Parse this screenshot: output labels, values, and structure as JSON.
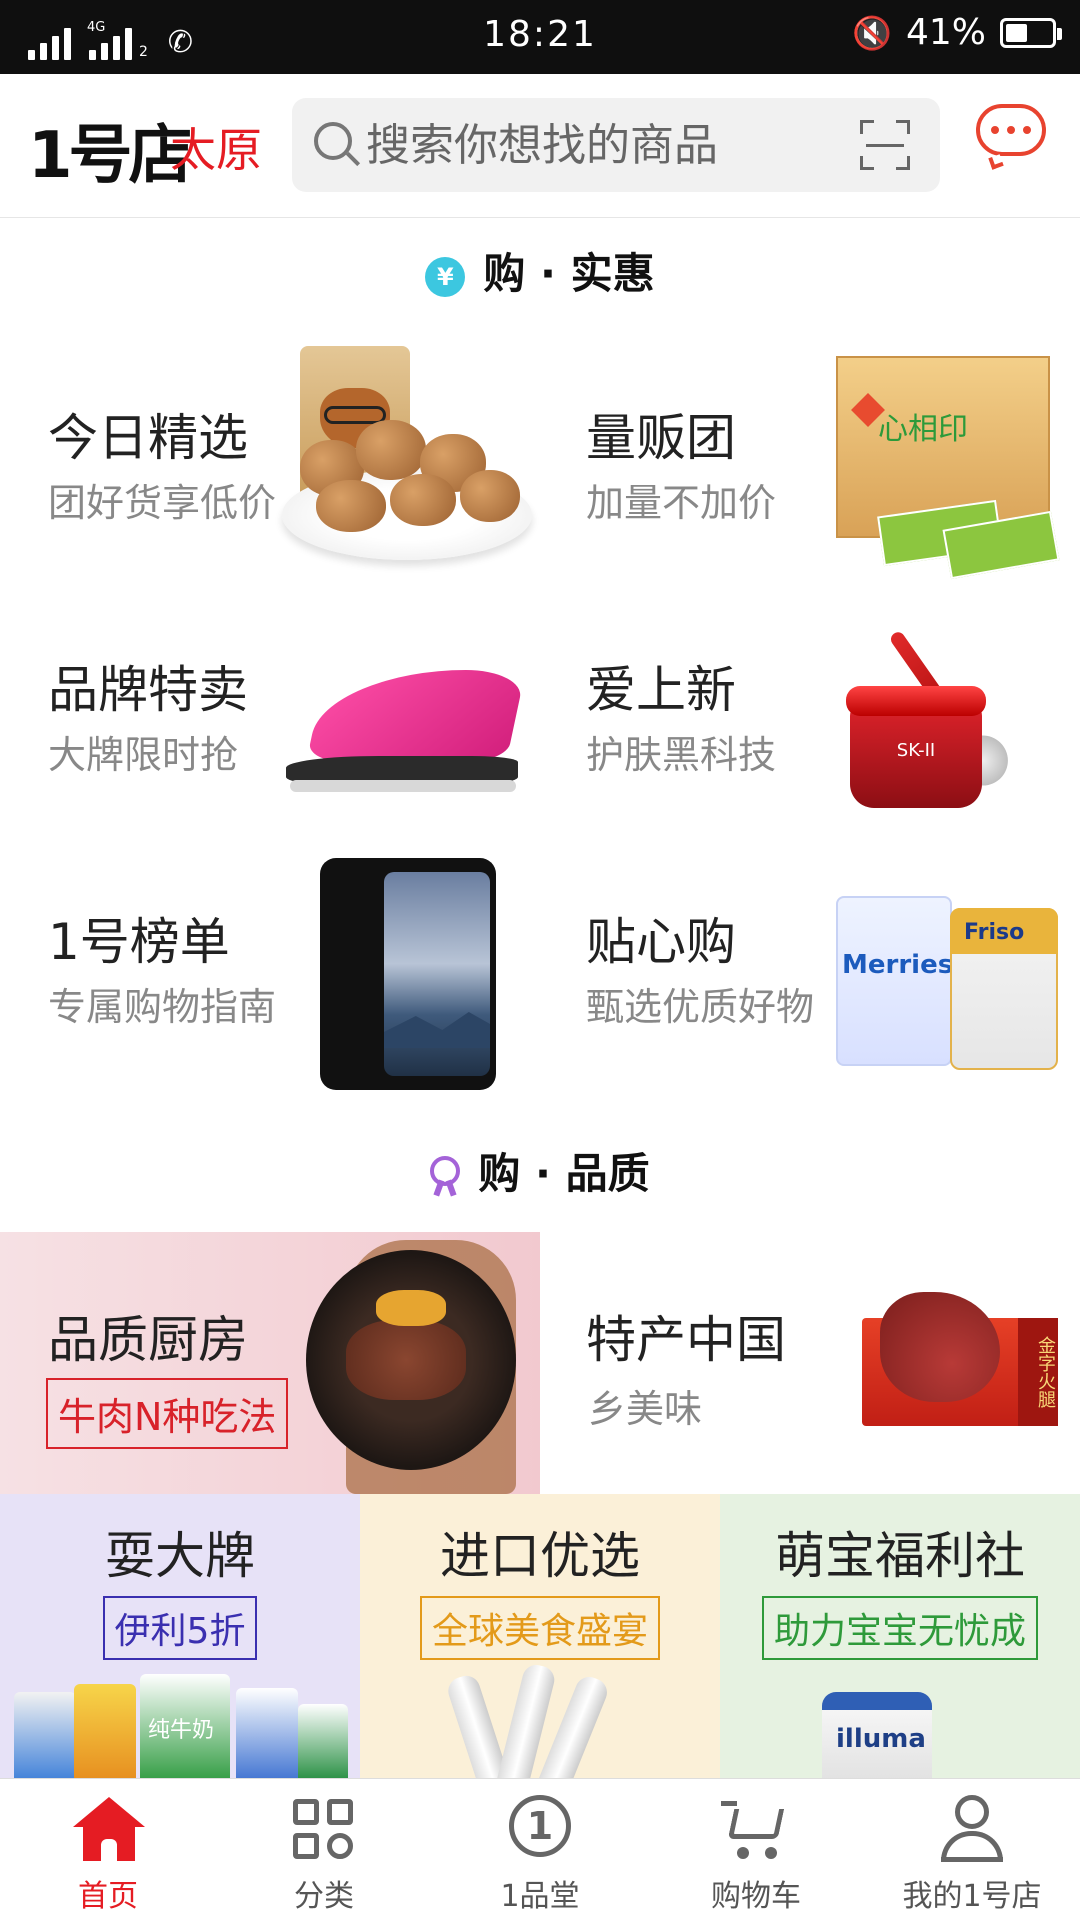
{
  "status_bar": {
    "network": "4G",
    "sim2": "2",
    "time": "18:21",
    "battery": "41%",
    "battery_level": 0.41
  },
  "header": {
    "logo_text": "1号店",
    "city": "太原",
    "search_placeholder": "搜索你想找的商品",
    "icons": [
      "search-icon",
      "scan-icon",
      "message-icon"
    ]
  },
  "section_deals": {
    "title": "购 · 实惠",
    "icon": "yen-icon"
  },
  "deal_cells": [
    {
      "title": "今日精选",
      "subtitle": "团好货享低价"
    },
    {
      "title": "量贩团",
      "subtitle": "加量不加价"
    },
    {
      "title": "品牌特卖",
      "subtitle": "大牌限时抢"
    },
    {
      "title": "爱上新",
      "subtitle": "护肤黑科技"
    },
    {
      "title": "1号榜单",
      "subtitle": "专属购物指南"
    },
    {
      "title": "贴心购",
      "subtitle": "甄选优质好物"
    }
  ],
  "product_texts": {
    "tissue_brand": "心相印",
    "skii": "SK-II",
    "diapers": "Merries",
    "formula": "Friso"
  },
  "section_quality": {
    "title": "购 · 品质",
    "icon": "medal-icon"
  },
  "quality_banners": [
    {
      "title": "品质厨房",
      "tag": "牛肉N种吃法"
    },
    {
      "title": "特产中国",
      "subtitle": "乡美味",
      "box_text": "金字火腿"
    }
  ],
  "tiles": [
    {
      "title": "耍大牌",
      "tag": "伊利5折",
      "color": "#3a2fb0",
      "bg": "#e7e2f7"
    },
    {
      "title": "进口优选",
      "tag": "全球美食盛宴",
      "color": "#e39a1a",
      "bg": "#fbf0d8"
    },
    {
      "title": "萌宝福利社",
      "tag": "助力宝宝无忧成",
      "color": "#2e9a3a",
      "bg": "#e6f2e1"
    }
  ],
  "milk_labels": [
    "纯牛奶"
  ],
  "can_label": "illuma",
  "bottom_nav": [
    {
      "label": "首页",
      "icon": "home-icon",
      "active": true
    },
    {
      "label": "分类",
      "icon": "category-icon",
      "active": false
    },
    {
      "label": "1品堂",
      "icon": "pin-tang-icon",
      "active": false
    },
    {
      "label": "购物车",
      "icon": "cart-icon",
      "active": false
    },
    {
      "label": "我的1号店",
      "icon": "profile-icon",
      "active": false
    }
  ],
  "colors": {
    "brand_red": "#e51c23",
    "text_gray": "#888888"
  }
}
